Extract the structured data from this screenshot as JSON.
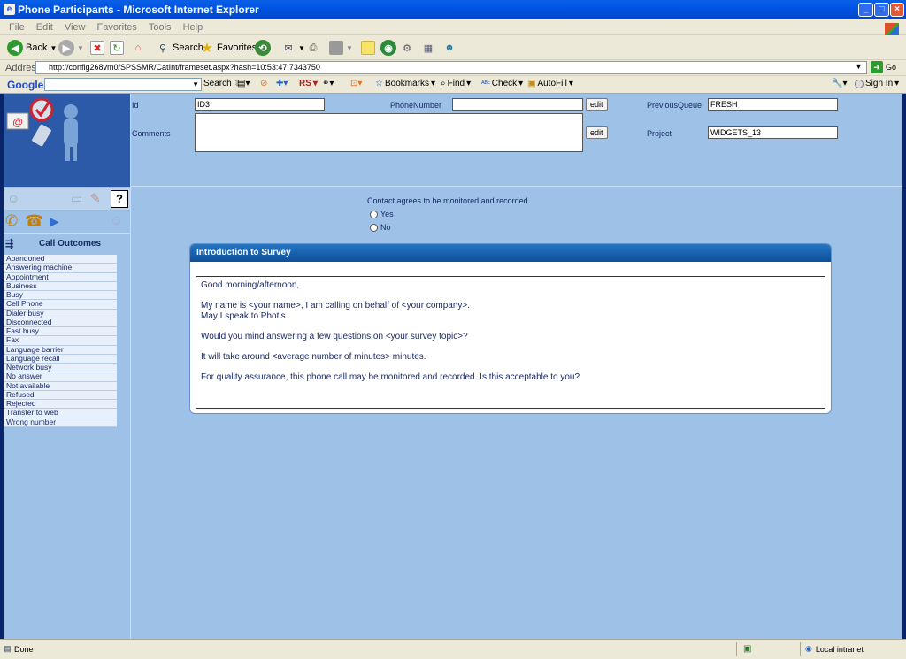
{
  "window": {
    "title": "Phone Participants - Microsoft Internet Explorer"
  },
  "menu": [
    "File",
    "Edit",
    "View",
    "Favorites",
    "Tools",
    "Help"
  ],
  "toolbar": {
    "back": "Back",
    "search": "Search",
    "favorites": "Favorites"
  },
  "address": {
    "label": "Address",
    "url": "http://config268vm0/SPSSMR/CatInt/frameset.aspx?hash=10:53:47.7343750",
    "go": "Go"
  },
  "google": {
    "logo": "Google",
    "search": "Search",
    "rs": "RS",
    "bookmarks": "Bookmarks",
    "find": "Find",
    "check": "Check",
    "autofill": "AutoFill",
    "signin": "Sign In"
  },
  "form": {
    "id_label": "Id",
    "id_value": "ID3",
    "phone_label": "PhoneNumber",
    "phone_value": "",
    "edit": "edit",
    "prevqueue_label": "PreviousQueue",
    "prevqueue_value": "FRESH",
    "comments_label": "Comments",
    "project_label": "Project",
    "project_value": "WIDGETS_13"
  },
  "help_label": "?",
  "outcomes": {
    "title": "Call Outcomes",
    "items": [
      "Abandoned",
      "Answering machine",
      "Appointment",
      "Business",
      "Busy",
      "Cell Phone",
      "Dialer busy",
      "Disconnected",
      "Fast busy",
      "Fax",
      "Language barrier",
      "Language recall",
      "Network busy",
      "No answer",
      "Not available",
      "Refused",
      "Rejected",
      "Transfer to web",
      "Wrong number"
    ]
  },
  "consent": {
    "question": "Contact agrees to be monitored and recorded",
    "yes": "Yes",
    "no": "No"
  },
  "survey": {
    "title": "Introduction to Survey",
    "greeting": "Good morning/afternoon,",
    "line1": "My name is <your name>, I am calling on behalf of <your company>.",
    "line2": "May I speak to Photis",
    "line3": "Would you mind answering a few questions on <your survey topic>?",
    "line4": "It will take around <average number of minutes> minutes.",
    "line5": "For quality assurance, this phone call may be monitored and recorded. Is this acceptable to you?"
  },
  "status": {
    "left": "Done",
    "zone": "Local intranet"
  }
}
